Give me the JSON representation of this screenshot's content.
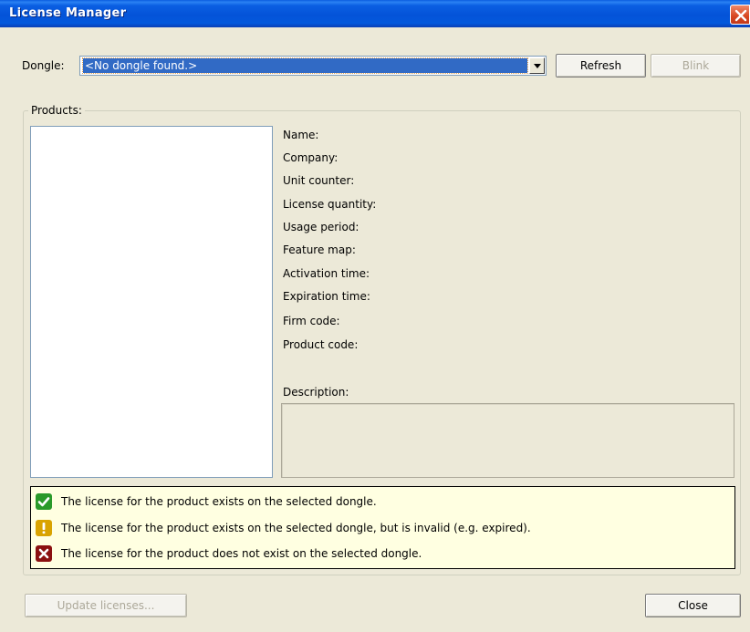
{
  "window": {
    "title": "License Manager"
  },
  "dongle": {
    "label": "Dongle:",
    "selected": "<No dongle found.>",
    "refresh_label": "Refresh",
    "blink_label": "Blink"
  },
  "products": {
    "group_label": "Products:",
    "items": []
  },
  "details": {
    "fields": [
      "Name:",
      "Company:",
      "Unit counter:",
      "License quantity:",
      "Usage period:",
      "Feature map:",
      "Activation time:",
      "Expiration time:",
      "Firm code:",
      "Product code:"
    ],
    "description_label": "Description:",
    "description_value": ""
  },
  "legend": {
    "valid": "The license for the product exists on the selected dongle.",
    "invalid": "The license for the product exists on the selected dongle, but is invalid (e.g. expired).",
    "missing": "The license for the product does not exist on the selected dongle.",
    "colors": {
      "valid": "#2a9a2a",
      "invalid": "#d9a300",
      "missing": "#8b1010"
    }
  },
  "footer": {
    "update_label": "Update licenses...",
    "close_label": "Close"
  }
}
